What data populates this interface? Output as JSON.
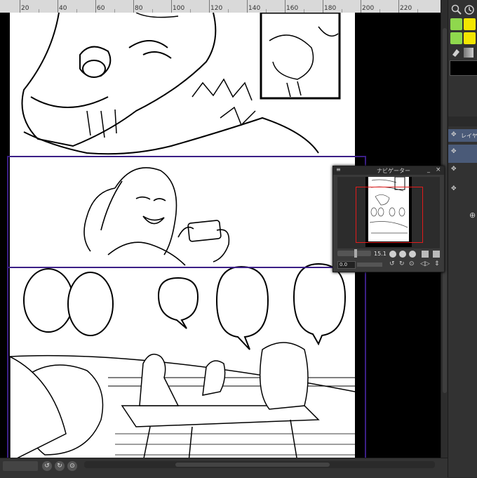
{
  "ruler": {
    "labels": [
      "20",
      "40",
      "60",
      "80",
      "100",
      "120",
      "140",
      "160",
      "180",
      "200",
      "220"
    ]
  },
  "navigator": {
    "title": "ナビゲーター",
    "zoom_value": "15.1",
    "angle_value": "0.0",
    "minimize_label": "_",
    "close_label": "×"
  },
  "right_panel": {
    "layer_tab_label": "レイヤ"
  },
  "colors": {
    "panel_frame": "#3b1f86",
    "navigator_viewport": "#e21b1b",
    "subtool_yellow": "#f2e600",
    "subtool_green": "#8fd84d"
  },
  "icons": {
    "search": "search-icon",
    "zoom": "zoom-icon",
    "move": "move-icon",
    "close": "close-icon",
    "rotate": "rotate-icon",
    "flip": "flip-icon"
  }
}
